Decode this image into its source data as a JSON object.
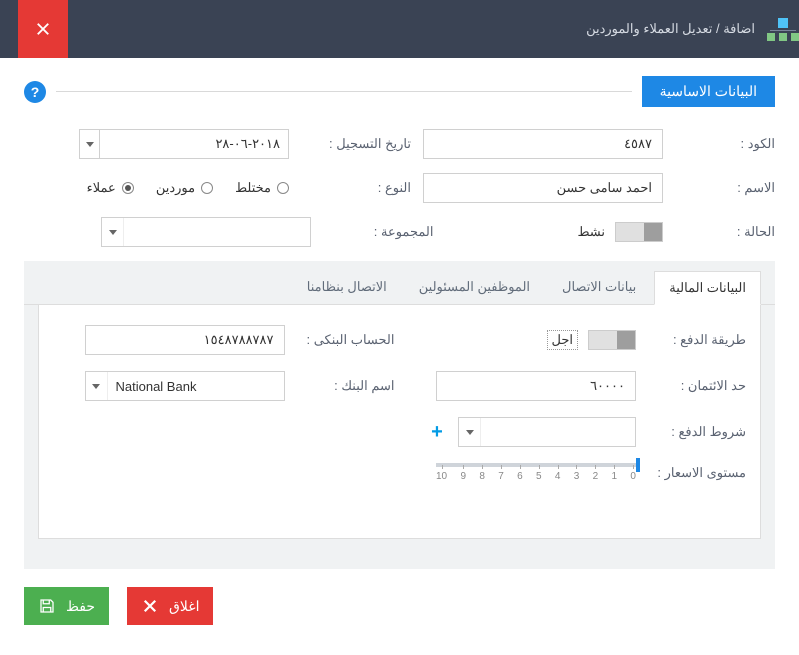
{
  "titlebar": {
    "title": "اضافة / تعديل العملاء والموردين"
  },
  "section": {
    "header": "البيانات الاساسية",
    "help": "?"
  },
  "fields": {
    "code_label": "الكود :",
    "code_value": "٤٥٨٧",
    "regdate_label": "تاريخ التسجيل :",
    "regdate_value": "٢٠١٨-٠٦-٢٨",
    "name_label": "الاسم :",
    "name_value": "احمد سامى حسن",
    "type_label": "النوع :",
    "type_options": {
      "mixed": "مختلط",
      "suppliers": "موردين",
      "customers": "عملاء"
    },
    "status_label": "الحالة :",
    "status_value": "نشط",
    "group_label": "المجموعة :",
    "group_value": ""
  },
  "tabs": {
    "financial": "البيانات المالية",
    "contact": "بيانات الاتصال",
    "officials": "الموظفين المسئولين",
    "syscontact": "الاتصال بنظامنا"
  },
  "financial": {
    "payment_method_label": "طريقة الدفع :",
    "payment_method_value": "اجل",
    "bank_account_label": "الحساب البنكى :",
    "bank_account_value": "١٥٤٨٧٨٨٧٨٧",
    "credit_limit_label": "حد الائتمان :",
    "credit_limit_value": "٦٠٠٠٠",
    "bank_name_label": "اسم البنك :",
    "bank_name_value": "National Bank",
    "payment_terms_label": "شروط الدفع :",
    "payment_terms_value": "",
    "price_level_label": "مستوى الاسعار :",
    "slider": {
      "min": 0,
      "max": 10,
      "value": 0
    }
  },
  "actions": {
    "save": "حفظ",
    "close": "اغلاق"
  }
}
